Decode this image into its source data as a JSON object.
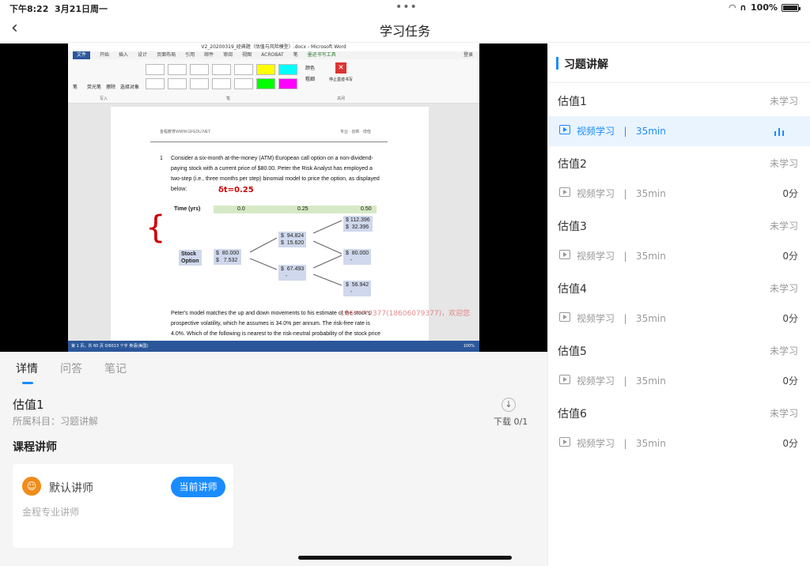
{
  "status": {
    "time": "下午8:22",
    "date": "3月21日周一",
    "battery": "100%"
  },
  "nav": {
    "title": "学习任务",
    "back_icon": "chevron-left-icon"
  },
  "video": {
    "word_title": "V2_20200319_经典题（估值与风险模型）.docx - Microsoft Word",
    "word_tabs": [
      "文件",
      "开始",
      "插入",
      "设计",
      "页面布局",
      "引用",
      "邮件",
      "审阅",
      "视图",
      "ACROBAT",
      "笔"
    ],
    "ink_tools_tab": "墨迹书写工具",
    "login": "登录",
    "pen_label": "笔",
    "highlighter_label": "荧光笔",
    "eraser_label": "擦除",
    "select_label": "选择对象",
    "write_group": "写入",
    "pen_group": "笔",
    "color_label": "颜色",
    "thickness_label": "粗细",
    "stop_ink_label": "停止墨迹书写",
    "close_group": "关闭",
    "doc_header_left": "金程教育WWW.GFEDU.NET",
    "doc_header_right": "专业 · 创新 · 增值",
    "question_number": "1",
    "question_lines": [
      "Consider a six-month at-the-money (ATM) European call option on a non-dividend-",
      "paying stock with a current price of $80.00. Peter the Risk Analyst has employed a",
      "two-step (i.e., three months per step) binomial model to price the option, as displayed",
      "below:"
    ],
    "ink_note": "δt=0.25",
    "tree_time_label": "Time (yrs)",
    "tree_times": [
      "0.0",
      "0.25",
      "0.50"
    ],
    "tree_row_labels": [
      "Stock",
      "Option"
    ],
    "tree_nodes": [
      "$  80.000\n$   7.532",
      "$  94.824\n$  15.620",
      "$  67.493\n   -",
      "$ 112.396\n$  32.396",
      "$  80.000\n   -",
      "$  56.942\n   -"
    ],
    "para_lines": [
      "Peter's model matches the up and down movements to his estimate of the stock's",
      "prospective volatility, which he assumes is 34.0% per annum. The risk-free rate is",
      "4.0%. Which of the following is nearest to the risk-neutral probability of the stock price"
    ],
    "watermark": "186****9377(18606079377)，欢迎您",
    "word_status": "第 1 页，共 60 页    0/6013 个字    英语(美国)",
    "zoom": "100%"
  },
  "tabs": [
    {
      "label": "详情",
      "active": true
    },
    {
      "label": "问答",
      "active": false
    },
    {
      "label": "笔记",
      "active": false
    }
  ],
  "details": {
    "title": "估值1",
    "subject": "所属科目：习题讲解",
    "download_label": "下载 0/1",
    "lecturer_heading": "课程讲师",
    "lecturer_name": "默认讲师",
    "lecturer_button": "当前讲师",
    "lecturer_desc": "金程专业讲师"
  },
  "panel": {
    "title": "习题讲解",
    "chapters": [
      {
        "title": "估值1",
        "status": "未学习",
        "lesson": "视频学习   |   35min",
        "progress": "",
        "active": true
      },
      {
        "title": "估值2",
        "status": "未学习",
        "lesson": "视频学习   |   35min",
        "progress": "0分",
        "active": false
      },
      {
        "title": "估值3",
        "status": "未学习",
        "lesson": "视频学习   |   35min",
        "progress": "0分",
        "active": false
      },
      {
        "title": "估值4",
        "status": "未学习",
        "lesson": "视频学习   |   35min",
        "progress": "0分",
        "active": false
      },
      {
        "title": "估值5",
        "status": "未学习",
        "lesson": "视频学习   |   35min",
        "progress": "0分",
        "active": false
      },
      {
        "title": "估值6",
        "status": "未学习",
        "lesson": "视频学习   |   35min",
        "progress": "0分",
        "active": false
      }
    ]
  }
}
